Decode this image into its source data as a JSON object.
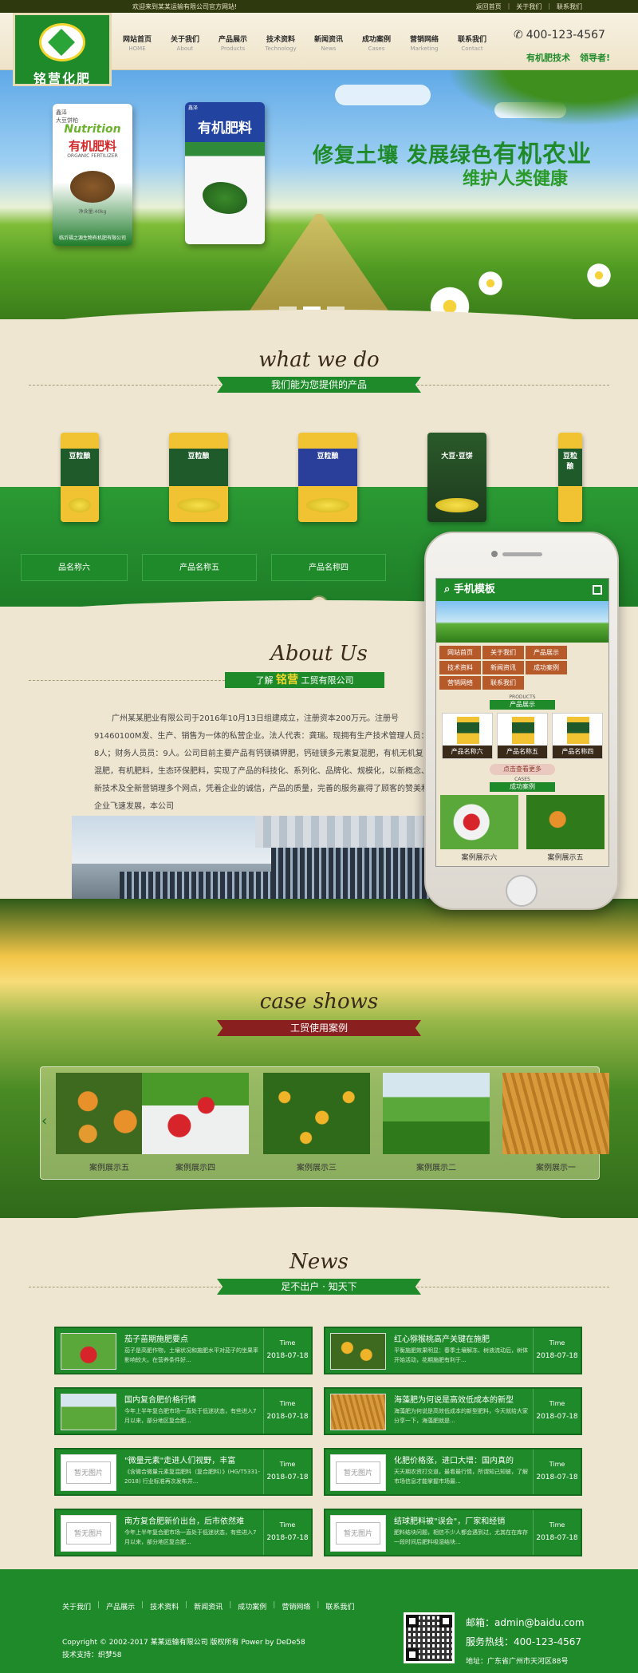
{
  "topbar": {
    "welcome": "欢迎来到某某运输有限公司官方网站!",
    "links": [
      "返回首页",
      "关于我们",
      "联系我们"
    ]
  },
  "logo": {
    "name": "铭营化肥"
  },
  "nav": [
    {
      "zh": "网站首页",
      "en": "HOME"
    },
    {
      "zh": "关于我们",
      "en": "About"
    },
    {
      "zh": "产品展示",
      "en": "Products"
    },
    {
      "zh": "技术资料",
      "en": "Technology"
    },
    {
      "zh": "新闻资讯",
      "en": "News"
    },
    {
      "zh": "成功案例",
      "en": "Cases"
    },
    {
      "zh": "营销网络",
      "en": "Marketing"
    },
    {
      "zh": "联系我们",
      "en": "Contact"
    }
  ],
  "header": {
    "phone": "400-123-4567",
    "slogan1": "有机肥技术",
    "slogan2": "领导者!",
    "phone_icon": "phone-icon"
  },
  "banner": {
    "headline_a": "修复土壤 发展绿色",
    "headline_b": "有机农业",
    "headline_2": "维护人类健康",
    "bag1": {
      "brand": "Nutrition",
      "tag": "鑫泽",
      "title": "有机肥料",
      "sub": "ORGANIC FERTILIZER",
      "variety": "大豆饼粕",
      "foot": "临沂福之源生物有机肥有限公司",
      "weight": "净含量:40kg"
    },
    "bag2": {
      "tag": "鑫泽",
      "title": "有机肥料"
    }
  },
  "products_section": {
    "script": "what we do",
    "ribbon": "我们能为您提供的产品",
    "items": [
      {
        "label": "品名称六",
        "pack_label": "豆粒酿"
      },
      {
        "label": "产品名称五",
        "pack_label": "豆粒酿"
      },
      {
        "label": "产品名称四",
        "pack_label": "豆粒酿"
      },
      {
        "label": "",
        "pack_label": "大豆·豆饼"
      },
      {
        "label": "",
        "pack_label": "豆粒酿"
      }
    ],
    "more_icon": "circle-down-icon"
  },
  "about_section": {
    "script": "About Us",
    "ribbon_pre": "了解",
    "ribbon_big": "铭营",
    "ribbon_post": "工贸有限公司",
    "text": "广州某某肥业有限公司于2016年10月13日组建成立，注册资本200万元。注册号91460100M发、生产、销售为一体的私营企业。法人代表：龚瑞。现拥有生产技术管理人员：8人；财务人员员：9人。公司目前主要产品有钙镁磷钾肥，钙硅镁多元素复混肥，有机无机复混肥，有机肥料，生态环保肥料，实现了产品的科技化、系列化、品牌化、规模化，以新概念、新技术及全新营销理多个网点，凭着企业的诚信，产品的质量，完善的服务赢得了顾客的赞美和企业飞速发展，本公司"
  },
  "phone_mock": {
    "title": "手机模板",
    "nav": [
      "网站首页",
      "关于我们",
      "产品展示",
      "技术资料",
      "新闻资讯",
      "成功案例",
      "营销网络",
      "联系我们"
    ],
    "products_en": "PRODUCTS",
    "products_ribbon": "产品展示",
    "products": [
      "产品名称六",
      "产品名称五",
      "产品名称四"
    ],
    "more": "点击查看更多",
    "cases_en": "CASES",
    "cases_ribbon": "成功案例",
    "cases": [
      "案例展示六",
      "案例展示五"
    ]
  },
  "cases_section": {
    "script": "case shows",
    "ribbon": "工贸使用案例",
    "items": [
      "案例展示五",
      "案例展示四",
      "案例展示三",
      "案例展示二",
      "案例展示一"
    ],
    "prev_icon": "chevron-left-icon",
    "next_icon": "chevron-right-icon"
  },
  "news_section": {
    "script": "News",
    "ribbon": "足不出户 · 知天下",
    "time_label": "Time",
    "items": [
      {
        "title": "茄子苗期施肥要点",
        "desc": "茄子是高肥作物，土壤状况和施肥水平对茄子的坐果率影响较大。在营养条件好...",
        "date": "2018-07-18",
        "thumb": "image",
        "placeholder": ""
      },
      {
        "title": "红心猕猴桃高产关键在施肥",
        "desc": "平衡施肥效果明显：春季土壤解冻、树液流动后，树体开始活动，花期施肥有利于...",
        "date": "2018-07-18",
        "thumb": "image",
        "placeholder": ""
      },
      {
        "title": "国内复合肥价格行情",
        "desc": "今年上半年复合肥市场一直处于低迷状态，有些进入7月以来，部分地区复合肥...",
        "date": "2018-07-18",
        "thumb": "image",
        "placeholder": ""
      },
      {
        "title": "海藻肥为何说是高效低成本的新型",
        "desc": "海藻肥为何说是高效低成本的新型肥料，今天就给大家分享一下，海藻肥就是...",
        "date": "2018-07-18",
        "thumb": "image",
        "placeholder": ""
      },
      {
        "title": "\"微量元素\"走进人们视野，丰富",
        "desc": "《含微合微量元素复混肥料（复合肥料）》(HG/T5331-2018) 行业标准再次发布并...",
        "date": "2018-07-18",
        "thumb": "placeholder",
        "placeholder": "暂无图片"
      },
      {
        "title": "化肥价格涨，进口大增：国内真的",
        "desc": "天天期农资打交道，最看最行情，所谓知己知彼，了解市场信息才能掌握市场最...",
        "date": "2018-07-18",
        "thumb": "placeholder",
        "placeholder": "暂无图片"
      },
      {
        "title": "南方复合肥新价出台，后市依然难",
        "desc": "今年上半年复合肥市场一直处于低迷状态，有些进入7月以来，部分地区复合肥...",
        "date": "2018-07-18",
        "thumb": "placeholder",
        "placeholder": "暂无图片"
      },
      {
        "title": "结球肥料被\"误会\"，厂家和经销",
        "desc": "肥料结块问题，相信不少人都会遇到过，尤其在在库存一段时间后肥料吸湿结块...",
        "date": "2018-07-18",
        "thumb": "placeholder",
        "placeholder": "暂无图片"
      }
    ]
  },
  "footer": {
    "links": [
      "关于我们",
      "产品展示",
      "技术资料",
      "新闻资讯",
      "成功案例",
      "营销网络",
      "联系我们"
    ],
    "copyright": "Copyright © 2002-2017 某某运输有限公司 版权所有 Power by DeDe58",
    "tech": "技术支持：织梦58",
    "email": "邮箱：admin@baidu.com",
    "hotline": "服务热线：400-123-4567",
    "address": "地址：广东省广州市天河区88号"
  },
  "colors": {
    "brand_green": "#1f8a2a",
    "topbar": "#2e3a0e",
    "page_bg": "#efe6d2",
    "case_red": "#8a1f1f"
  }
}
